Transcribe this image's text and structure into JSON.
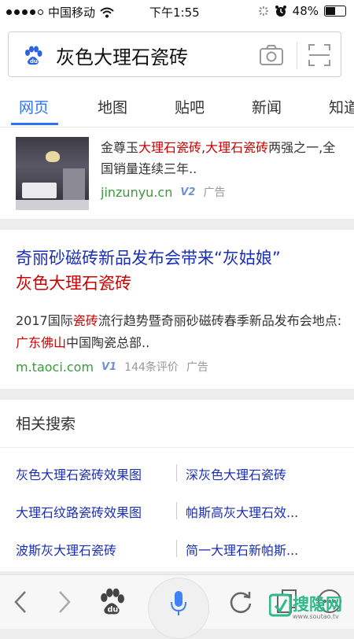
{
  "status_bar": {
    "carrier": "中国移动",
    "time": "下午1:55",
    "battery": "48%"
  },
  "search": {
    "query": "灰色大理石瓷砖"
  },
  "tabs": [
    {
      "label": "网页",
      "active": true
    },
    {
      "label": "地图",
      "active": false
    },
    {
      "label": "贴吧",
      "active": false
    },
    {
      "label": "新闻",
      "active": false
    },
    {
      "label": "知道",
      "active": false
    }
  ],
  "result1": {
    "desc_parts": [
      "金尊玉",
      "大理石瓷砖",
      ",",
      "大理石瓷砖",
      "两强之一,全国销量连续三年.."
    ],
    "domain": "jinzunyu.cn",
    "v_badge": "V2",
    "ad": "广告"
  },
  "result2": {
    "title_line1": "奇丽砂磁砖新品发布会带来“灰姑娘”",
    "title_line2": "灰色大理石瓷砖",
    "desc_a": "2017国际",
    "desc_b": "瓷砖",
    "desc_c": "流行趋势暨奇丽砂磁砖春季新品发布会地点:",
    "desc_d": "广东佛山",
    "desc_e": "中国陶瓷总部..",
    "domain": "m.taoci.com",
    "v_badge": "V1",
    "reviews": "144条评价",
    "ad": "广告"
  },
  "related": {
    "title": "相关搜索",
    "items": [
      "灰色大理石瓷砖效果图",
      "深灰色大理石瓷砖",
      "大理石纹路瓷砖效果图",
      "帕斯高灰大理石效...",
      "波斯灰大理石瓷砖",
      "简一大理石新帕斯..."
    ]
  },
  "watermark": {
    "text": "搜隐网",
    "sub": "www.soutao.tv"
  },
  "colors": {
    "accent": "#3072f6",
    "link": "#1a2fb4",
    "highlight": "#cc0000",
    "url_green": "#3a9a3a"
  }
}
